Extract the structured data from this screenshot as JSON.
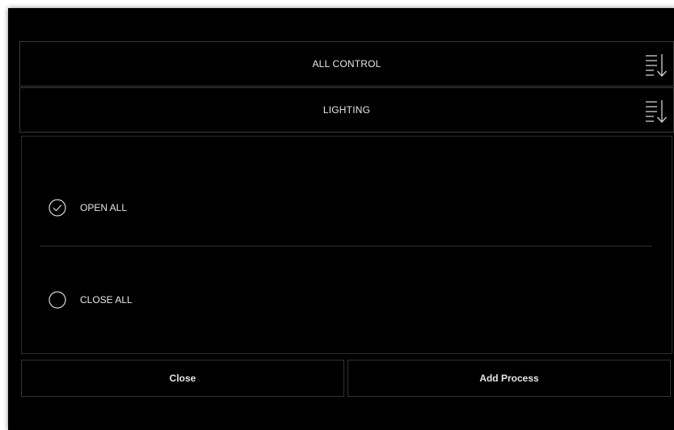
{
  "dropdowns": [
    {
      "label": "ALL CONTROL",
      "icon": "list-sort-icon"
    },
    {
      "label": "LIGHTING",
      "icon": "list-sort-icon"
    }
  ],
  "options": [
    {
      "label": "OPEN ALL",
      "selected": true,
      "icon": "radio-checked-icon"
    },
    {
      "label": "CLOSE ALL",
      "selected": false,
      "icon": "radio-unchecked-icon"
    }
  ],
  "buttons": {
    "close_label": "Close",
    "add_process_label": "Add Process"
  },
  "colors": {
    "background": "#000000",
    "text": "#e6e6e6",
    "border": "#3a3a3a"
  }
}
